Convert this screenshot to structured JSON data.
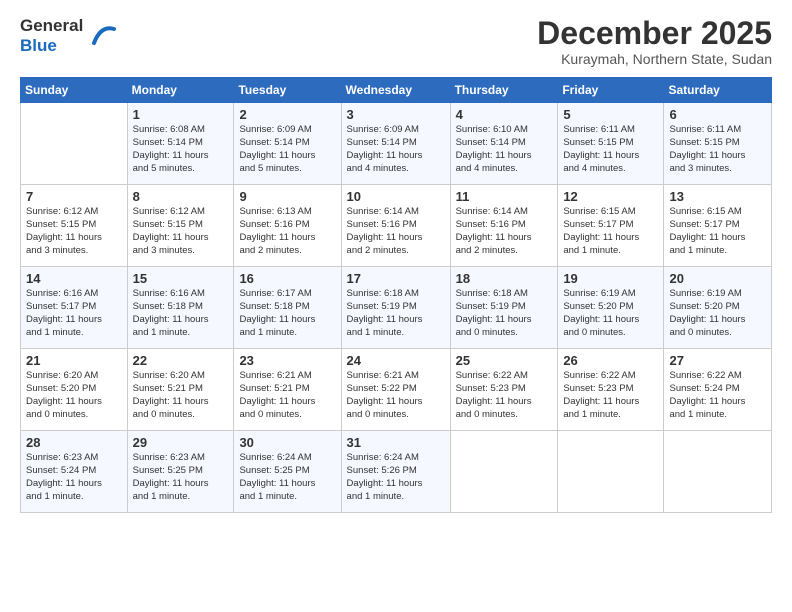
{
  "header": {
    "logo_line1": "General",
    "logo_line2": "Blue",
    "month": "December 2025",
    "location": "Kuraymah, Northern State, Sudan"
  },
  "weekdays": [
    "Sunday",
    "Monday",
    "Tuesday",
    "Wednesday",
    "Thursday",
    "Friday",
    "Saturday"
  ],
  "weeks": [
    [
      {
        "day": "",
        "info": ""
      },
      {
        "day": "1",
        "info": "Sunrise: 6:08 AM\nSunset: 5:14 PM\nDaylight: 11 hours\nand 5 minutes."
      },
      {
        "day": "2",
        "info": "Sunrise: 6:09 AM\nSunset: 5:14 PM\nDaylight: 11 hours\nand 5 minutes."
      },
      {
        "day": "3",
        "info": "Sunrise: 6:09 AM\nSunset: 5:14 PM\nDaylight: 11 hours\nand 4 minutes."
      },
      {
        "day": "4",
        "info": "Sunrise: 6:10 AM\nSunset: 5:14 PM\nDaylight: 11 hours\nand 4 minutes."
      },
      {
        "day": "5",
        "info": "Sunrise: 6:11 AM\nSunset: 5:15 PM\nDaylight: 11 hours\nand 4 minutes."
      },
      {
        "day": "6",
        "info": "Sunrise: 6:11 AM\nSunset: 5:15 PM\nDaylight: 11 hours\nand 3 minutes."
      }
    ],
    [
      {
        "day": "7",
        "info": "Sunrise: 6:12 AM\nSunset: 5:15 PM\nDaylight: 11 hours\nand 3 minutes."
      },
      {
        "day": "8",
        "info": "Sunrise: 6:12 AM\nSunset: 5:15 PM\nDaylight: 11 hours\nand 3 minutes."
      },
      {
        "day": "9",
        "info": "Sunrise: 6:13 AM\nSunset: 5:16 PM\nDaylight: 11 hours\nand 2 minutes."
      },
      {
        "day": "10",
        "info": "Sunrise: 6:14 AM\nSunset: 5:16 PM\nDaylight: 11 hours\nand 2 minutes."
      },
      {
        "day": "11",
        "info": "Sunrise: 6:14 AM\nSunset: 5:16 PM\nDaylight: 11 hours\nand 2 minutes."
      },
      {
        "day": "12",
        "info": "Sunrise: 6:15 AM\nSunset: 5:17 PM\nDaylight: 11 hours\nand 1 minute."
      },
      {
        "day": "13",
        "info": "Sunrise: 6:15 AM\nSunset: 5:17 PM\nDaylight: 11 hours\nand 1 minute."
      }
    ],
    [
      {
        "day": "14",
        "info": "Sunrise: 6:16 AM\nSunset: 5:17 PM\nDaylight: 11 hours\nand 1 minute."
      },
      {
        "day": "15",
        "info": "Sunrise: 6:16 AM\nSunset: 5:18 PM\nDaylight: 11 hours\nand 1 minute."
      },
      {
        "day": "16",
        "info": "Sunrise: 6:17 AM\nSunset: 5:18 PM\nDaylight: 11 hours\nand 1 minute."
      },
      {
        "day": "17",
        "info": "Sunrise: 6:18 AM\nSunset: 5:19 PM\nDaylight: 11 hours\nand 1 minute."
      },
      {
        "day": "18",
        "info": "Sunrise: 6:18 AM\nSunset: 5:19 PM\nDaylight: 11 hours\nand 0 minutes."
      },
      {
        "day": "19",
        "info": "Sunrise: 6:19 AM\nSunset: 5:20 PM\nDaylight: 11 hours\nand 0 minutes."
      },
      {
        "day": "20",
        "info": "Sunrise: 6:19 AM\nSunset: 5:20 PM\nDaylight: 11 hours\nand 0 minutes."
      }
    ],
    [
      {
        "day": "21",
        "info": "Sunrise: 6:20 AM\nSunset: 5:20 PM\nDaylight: 11 hours\nand 0 minutes."
      },
      {
        "day": "22",
        "info": "Sunrise: 6:20 AM\nSunset: 5:21 PM\nDaylight: 11 hours\nand 0 minutes."
      },
      {
        "day": "23",
        "info": "Sunrise: 6:21 AM\nSunset: 5:21 PM\nDaylight: 11 hours\nand 0 minutes."
      },
      {
        "day": "24",
        "info": "Sunrise: 6:21 AM\nSunset: 5:22 PM\nDaylight: 11 hours\nand 0 minutes."
      },
      {
        "day": "25",
        "info": "Sunrise: 6:22 AM\nSunset: 5:23 PM\nDaylight: 11 hours\nand 0 minutes."
      },
      {
        "day": "26",
        "info": "Sunrise: 6:22 AM\nSunset: 5:23 PM\nDaylight: 11 hours\nand 1 minute."
      },
      {
        "day": "27",
        "info": "Sunrise: 6:22 AM\nSunset: 5:24 PM\nDaylight: 11 hours\nand 1 minute."
      }
    ],
    [
      {
        "day": "28",
        "info": "Sunrise: 6:23 AM\nSunset: 5:24 PM\nDaylight: 11 hours\nand 1 minute."
      },
      {
        "day": "29",
        "info": "Sunrise: 6:23 AM\nSunset: 5:25 PM\nDaylight: 11 hours\nand 1 minute."
      },
      {
        "day": "30",
        "info": "Sunrise: 6:24 AM\nSunset: 5:25 PM\nDaylight: 11 hours\nand 1 minute."
      },
      {
        "day": "31",
        "info": "Sunrise: 6:24 AM\nSunset: 5:26 PM\nDaylight: 11 hours\nand 1 minute."
      },
      {
        "day": "",
        "info": ""
      },
      {
        "day": "",
        "info": ""
      },
      {
        "day": "",
        "info": ""
      }
    ]
  ]
}
